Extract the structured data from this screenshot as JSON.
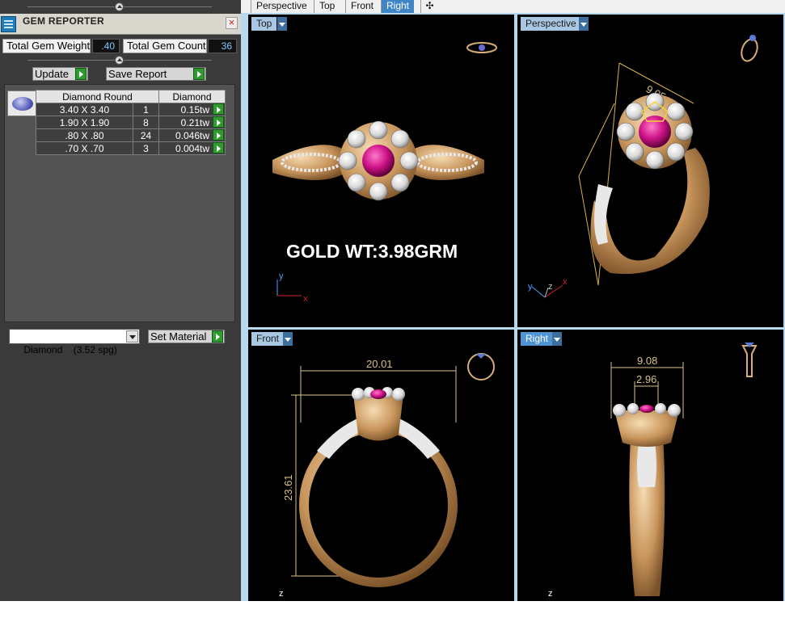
{
  "panel": {
    "title": "GEM REPORTER",
    "total_weight_label": "Total Gem Weight",
    "total_weight_value": ".40",
    "total_count_label": "Total Gem Count",
    "total_count_value": "36",
    "update_label": "Update",
    "save_report_label": "Save Report",
    "table": {
      "shape_header": "Diamond Round",
      "material_header": "Diamond",
      "rows": [
        {
          "size": "3.40 X 3.40",
          "count": "1",
          "weight": "0.15tw"
        },
        {
          "size": "1.90 X 1.90",
          "count": "8",
          "weight": "0.21tw"
        },
        {
          "size": ".80 X .80",
          "count": "24",
          "weight": "0.046tw"
        },
        {
          "size": ".70 X .70",
          "count": "3",
          "weight": "0.004tw"
        }
      ]
    },
    "material_select_value": "Diamond    (3.52 spg)",
    "set_material_label": "Set Material"
  },
  "tabs": [
    "Perspective",
    "Top",
    "Front",
    "Right"
  ],
  "active_tab": "Right",
  "add_tab_icon": "plus-icon",
  "viewports": {
    "top": {
      "label": "Top",
      "annotation": "GOLD WT:3.98GRM"
    },
    "perspective": {
      "label": "Perspective",
      "dimension": "9.05"
    },
    "front": {
      "label": "Front",
      "width": "20.01",
      "height": "23.61"
    },
    "right": {
      "label": "Right",
      "width": "9.08",
      "inner_width": "2.96"
    }
  },
  "axes": {
    "x": "x",
    "y": "y",
    "z": "z"
  },
  "colors": {
    "panel_bg": "#3a3a3a",
    "viewport_bg": "#000000",
    "gold": "#d8ad78",
    "ruby": "#d0148a",
    "dimension_line": "#d9c08a",
    "tab_active": "#3f85c6"
  }
}
